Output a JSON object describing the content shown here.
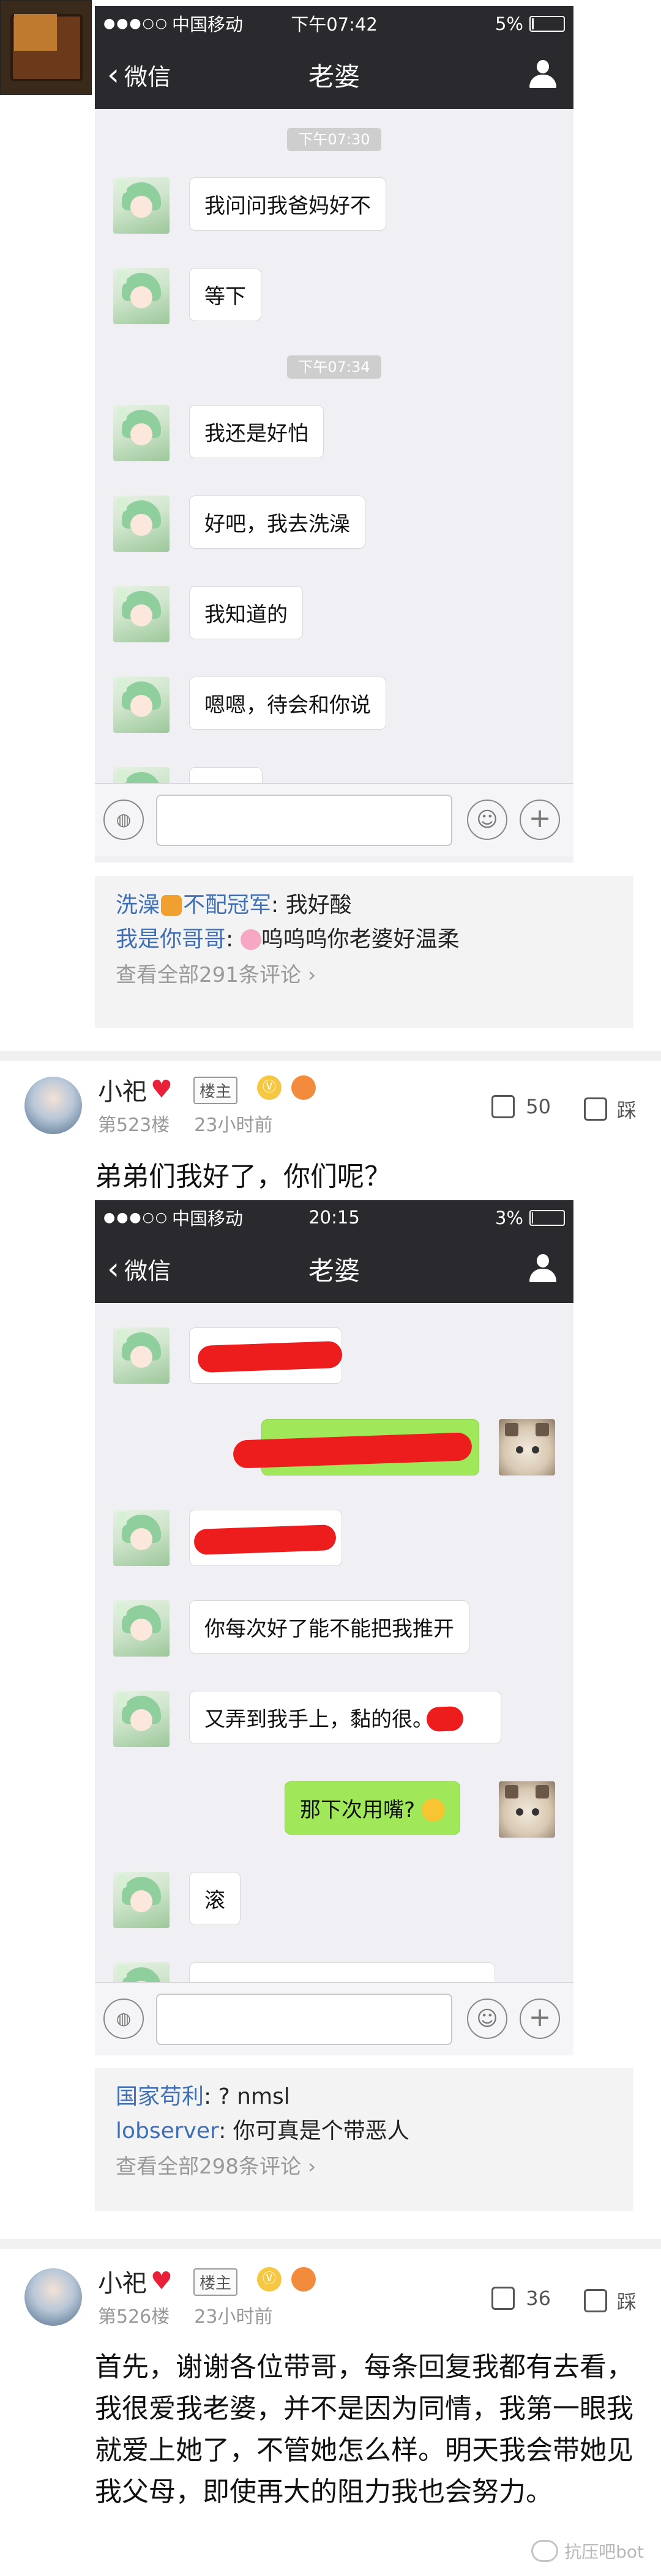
{
  "screenshot1": {
    "status": {
      "signal": "●●●○○",
      "carrier": "中国移动",
      "time": "下午07:42",
      "battery": "5%",
      "battery_level": 0.05
    },
    "nav": {
      "back": "微信",
      "title": "老婆"
    },
    "timestamps": [
      "下午07:30",
      "下午07:34"
    ],
    "messages": [
      "我问问我爸妈好不",
      "等下",
      "我还是好怕",
      "好吧，我去洗澡",
      "我知道的",
      "嗯嗯，待会和你说"
    ]
  },
  "replies1": [
    {
      "user": "洗澡",
      "user_suffix": "不配冠军",
      "text": "我好酸"
    },
    {
      "user": "我是你哥哥",
      "text": "呜呜呜你老婆好温柔"
    }
  ],
  "view_all1": "查看全部291条评论",
  "post1": {
    "name": "小祀",
    "badge": "楼主",
    "level_icon": "level-badge-icon",
    "floor": "第523楼",
    "time": "23小时前",
    "likes": "50",
    "dislike": "踩",
    "text": "弟弟们我好了，你们呢？"
  },
  "screenshot2": {
    "status": {
      "signal": "●●●○○",
      "carrier": "中国移动",
      "time": "20:15",
      "battery": "3%",
      "battery_level": 0.03
    },
    "nav": {
      "back": "微信",
      "title": "老婆"
    },
    "messages": [
      {
        "side": "left",
        "text": "",
        "redacted": true
      },
      {
        "side": "right",
        "text": "",
        "redacted": true
      },
      {
        "side": "left",
        "text": "",
        "redacted": true
      },
      {
        "side": "left",
        "text": "你每次好了能不能把我推开"
      },
      {
        "side": "left",
        "text": "又弄到我手上，黏的很。"
      },
      {
        "side": "right",
        "text": "那下次用嘴?"
      },
      {
        "side": "left",
        "text": "滚"
      }
    ]
  },
  "replies2": [
    {
      "user": "国家苟利",
      "text": "? nmsl"
    },
    {
      "user": "lobserver",
      "text": "你可真是个带恶人"
    }
  ],
  "view_all2": "查看全部298条评论",
  "post2": {
    "name": "小祀",
    "badge": "楼主",
    "floor": "第526楼",
    "time": "23小时前",
    "likes": "36",
    "dislike": "踩",
    "text": "首先，谢谢各位带哥，每条回复我都有去看，我很爱我老婆，并不是因为同情，我第一眼我就爱上她了，不管她怎么样。明天我会带她见我父母，即使再大的阻力我也会努力。"
  },
  "watermark": "抗压吧bot",
  "colors": {
    "chat_bg": "#efeff4",
    "nav_bg": "#2a2a2e",
    "bubble_green": "#a0e75a",
    "link_blue": "#3f6fb5",
    "redaction": "#ee1d1d"
  }
}
